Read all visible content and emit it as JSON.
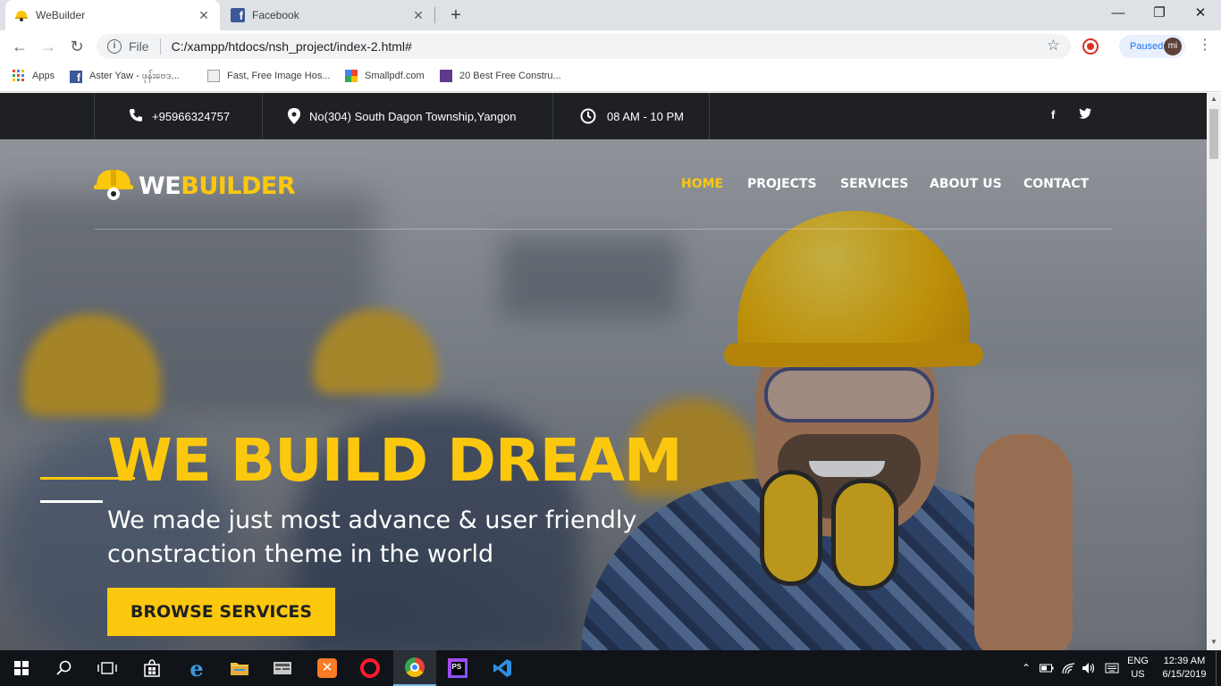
{
  "browser": {
    "tabs": [
      {
        "title": "WeBuilder",
        "active": true
      },
      {
        "title": "Facebook",
        "active": false
      }
    ],
    "address": {
      "scheme_label": "File",
      "url": "C:/xampp/htdocs/nsh_project/index-2.html#"
    },
    "profile": {
      "status": "Paused",
      "initials": "mi"
    },
    "bookmarks": [
      {
        "label": "Apps"
      },
      {
        "label": "Aster Yaw - ဖုန်းဗေဒ..."
      },
      {
        "label": "Fast, Free Image Hos..."
      },
      {
        "label": "Smallpdf.com"
      },
      {
        "label": "20 Best Free Constru..."
      }
    ]
  },
  "site": {
    "topbar": {
      "phone": "+95966324757",
      "address": "No(304) South Dagon Township,Yangon",
      "hours": "08 AM - 10 PM",
      "social": [
        "f",
        "twitter"
      ]
    },
    "logo": {
      "part1": "WE",
      "part2": "BUILDER"
    },
    "nav": [
      {
        "label": "HOME",
        "active": true
      },
      {
        "label": "PROJECTS",
        "active": false
      },
      {
        "label": "SERVICES",
        "active": false
      },
      {
        "label": "ABOUT US",
        "active": false
      },
      {
        "label": "CONTACT",
        "active": false
      }
    ],
    "hero": {
      "headline": "WE BUILD DREAM",
      "subtitle": "We made just most advance & user friendly constraction theme in the world",
      "cta": "BROWSE SERVICES"
    },
    "colors": {
      "accent": "#fcc80e",
      "dark": "#1e2024"
    }
  },
  "taskbar": {
    "lang": {
      "line1": "ENG",
      "line2": "US"
    },
    "clock": {
      "time": "12:39 AM",
      "date": "6/15/2019"
    },
    "apps": [
      "start",
      "search",
      "task-view",
      "store",
      "edge",
      "file-explorer",
      "terminal",
      "xampp",
      "opera",
      "chrome",
      "phpstorm",
      "vscode"
    ]
  }
}
